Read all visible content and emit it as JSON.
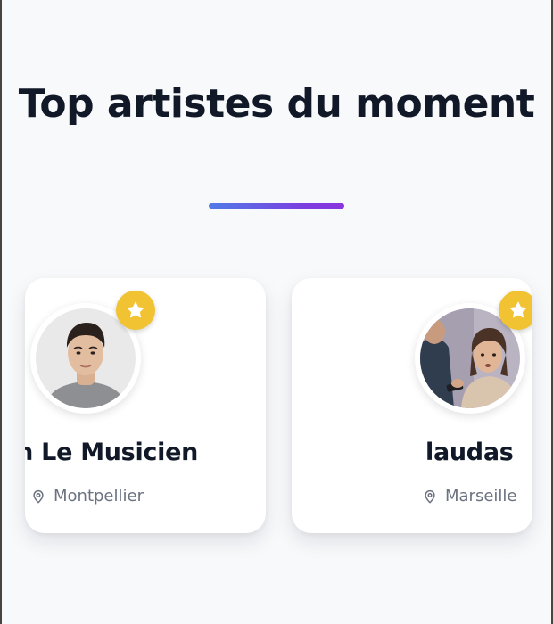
{
  "section": {
    "title": "Top artistes du moment"
  },
  "artists": [
    {
      "name": "aph Le Musicien",
      "city": "Montpellier",
      "avatar": "portrait-young-man",
      "badge_icon": "star-icon"
    },
    {
      "name": "laudas",
      "city": "Marseille",
      "avatar": "photo-couple-arguing",
      "badge_icon": "star-icon"
    }
  ],
  "colors": {
    "background": "#f8f9fb",
    "title": "#111827",
    "accent_start": "#4f7ce8",
    "accent_end": "#8b35dd",
    "badge": "#f1c232",
    "muted_text": "#6b7280"
  }
}
